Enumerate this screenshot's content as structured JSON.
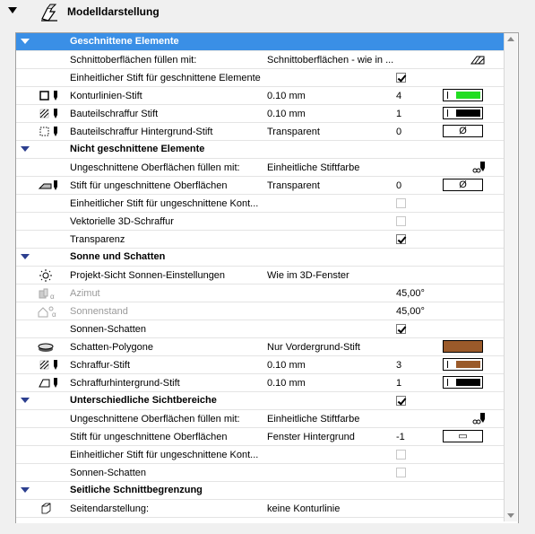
{
  "header": {
    "title": "Modelldarstellung",
    "icon": "model-display-icon"
  },
  "sections": {
    "cut": {
      "title": "Geschnittene Elemente",
      "rows": {
        "fill": {
          "label": "Schnittoberflächen füllen mit:",
          "value": "Schnittoberflächen - wie in ..."
        },
        "uniform_pen": {
          "label": "Einheitlicher Stift für geschnittene Elemente",
          "checked": true
        },
        "contour": {
          "label": "Konturlinien-Stift",
          "value": "0.10 mm",
          "num": "4",
          "color": "#22dd22"
        },
        "hatch": {
          "label": "Bauteilschraffur Stift",
          "value": "0.10 mm",
          "num": "1",
          "color": "#000000"
        },
        "hatch_bg": {
          "label": "Bauteilschraffur Hintergrund-Stift",
          "value": "Transparent",
          "num": "0",
          "symbol": "Ø"
        }
      }
    },
    "uncut": {
      "title": "Nicht geschnittene Elemente",
      "rows": {
        "fill": {
          "label": "Ungeschnittene Oberflächen füllen mit:",
          "value": "Einheitliche Stiftfarbe"
        },
        "pen": {
          "label": "Stift für ungeschnittene Oberflächen",
          "value": "Transparent",
          "num": "0",
          "symbol": "Ø"
        },
        "uniform_pen": {
          "label": "Einheitlicher Stift für ungeschnittene Kont...",
          "checked": false
        },
        "vector_hatch": {
          "label": "Vektorielle 3D-Schraffur",
          "checked": false
        },
        "transparency": {
          "label": "Transparenz",
          "checked": true
        }
      }
    },
    "sun": {
      "title": "Sonne und Schatten",
      "rows": {
        "project_sun": {
          "label": "Projekt-Sicht Sonnen-Einstellungen",
          "value": "Wie im 3D-Fenster"
        },
        "azimuth": {
          "label": "Azimut",
          "num": "45,00°"
        },
        "altitude": {
          "label": "Sonnenstand",
          "num": "45,00°"
        },
        "shadows": {
          "label": "Sonnen-Schatten",
          "checked": true
        },
        "shadow_poly": {
          "label": "Schatten-Polygone",
          "value": "Nur Vordergrund-Stift",
          "color": "#9a5a2a"
        },
        "hatch_pen": {
          "label": "Schraffur-Stift",
          "value": "0.10 mm",
          "num": "3",
          "color": "#9a5a2a"
        },
        "hatch_bg_pen": {
          "label": "Schraffurhintergrund-Stift",
          "value": "0.10 mm",
          "num": "1",
          "color": "#000000"
        }
      }
    },
    "views": {
      "title": "Unterschiedliche Sichtbereiche",
      "checked": true,
      "rows": {
        "fill": {
          "label": "Ungeschnittene Oberflächen füllen mit:",
          "value": "Einheitliche Stiftfarbe"
        },
        "pen": {
          "label": "Stift für ungeschnittene Oberflächen",
          "value": "Fenster Hintergrund",
          "num": "-1",
          "symbol": "▭"
        },
        "uniform_pen": {
          "label": "Einheitlicher Stift für ungeschnittene Kont...",
          "checked": false
        },
        "shadows": {
          "label": "Sonnen-Schatten",
          "checked": false
        }
      }
    },
    "side": {
      "title": "Seitliche Schnittbegrenzung",
      "rows": {
        "display": {
          "label": "Seitendarstellung:",
          "value": "keine Konturlinie"
        }
      }
    }
  }
}
